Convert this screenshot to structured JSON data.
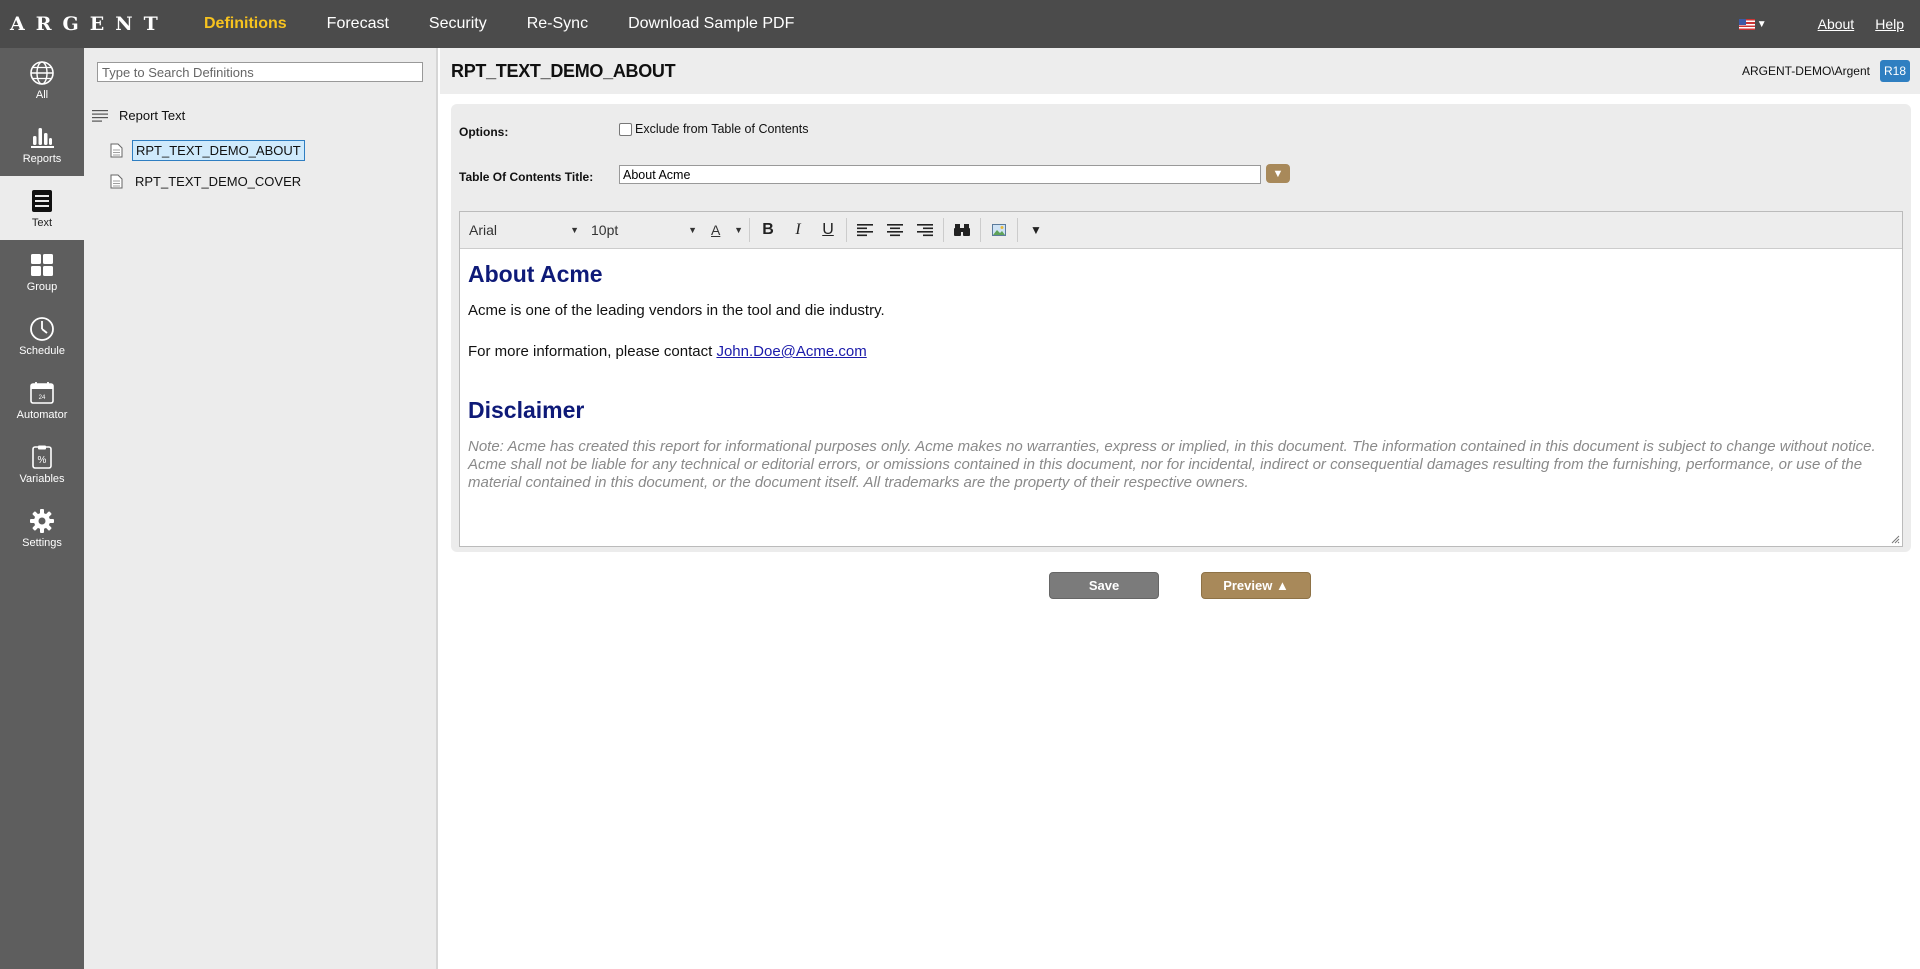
{
  "topbar": {
    "logo": "ARGENT",
    "nav": [
      "Definitions",
      "Forecast",
      "Security",
      "Re-Sync",
      "Download Sample PDF"
    ],
    "active_nav": "Definitions",
    "about_link": "About",
    "help_link": "Help",
    "flag_icon": "us-flag-icon"
  },
  "rail": {
    "items": [
      {
        "label": "All",
        "icon": "globe-icon"
      },
      {
        "label": "Reports",
        "icon": "bar-chart-icon"
      },
      {
        "label": "Text",
        "icon": "text-lines-icon"
      },
      {
        "label": "Group",
        "icon": "grid-icon"
      },
      {
        "label": "Schedule",
        "icon": "clock-icon"
      },
      {
        "label": "Automator",
        "icon": "calendar-icon"
      },
      {
        "label": "Variables",
        "icon": "clipboard-percent-icon"
      },
      {
        "label": "Settings",
        "icon": "gear-icon"
      }
    ],
    "active": "Text"
  },
  "tree": {
    "search_placeholder": "Type to Search Definitions",
    "root_label": "Report Text",
    "items": [
      "RPT_TEXT_DEMO_ABOUT",
      "RPT_TEXT_DEMO_COVER"
    ],
    "selected": "RPT_TEXT_DEMO_ABOUT"
  },
  "main": {
    "title": "RPT_TEXT_DEMO_ABOUT",
    "user": "ARGENT-DEMO\\Argent",
    "release_badge": "R18",
    "options_label": "Options:",
    "exclude_toc_label": "Exclude from Table of Contents",
    "exclude_toc_checked": false,
    "toc_title_label": "Table Of Contents Title:",
    "toc_title_value": "About Acme"
  },
  "editor": {
    "font_family": "Arial",
    "font_size": "10pt",
    "font_color_label": "A",
    "content": {
      "heading1": "About Acme",
      "para1": "Acme is one of the leading vendors in the tool and die industry.",
      "para2_prefix": "For more information, please contact ",
      "para2_link": "John.Doe@Acme.com",
      "heading2": "Disclaimer",
      "note": "Note: Acme has created this report for informational purposes only. Acme makes no warranties, express or implied, in this document. The information contained in this document is subject to change without notice. Acme shall not be liable for any technical or editorial errors, or omissions contained in this document, nor for incidental, indirect or consequential damages resulting from the furnishing, performance, or use of the material contained in this document, or the document itself. All trademarks are the property of their respective owners."
    }
  },
  "buttons": {
    "save": "Save",
    "preview": "Preview ▲"
  },
  "colors": {
    "topbar": "#4b4b4b",
    "active_nav": "#f7c31f",
    "accent_brown": "#a8895a",
    "heading_navy": "#0e1a78",
    "badge_blue": "#2f7fc1"
  }
}
